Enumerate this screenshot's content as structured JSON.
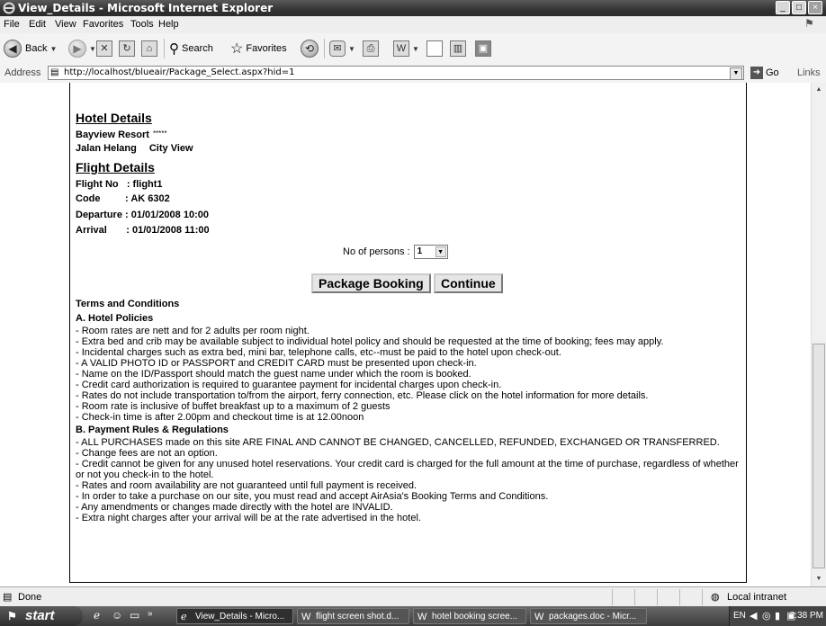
{
  "window": {
    "title": "View_Details - Microsoft Internet Explorer",
    "buttons": {
      "minimize": "_",
      "maximize": "□",
      "close": "×"
    }
  },
  "menu": [
    "File",
    "Edit",
    "View",
    "Favorites",
    "Tools",
    "Help"
  ],
  "toolbar": {
    "back_label": "Back",
    "search_label": "Search",
    "favorites_label": "Favorites"
  },
  "address": {
    "label": "Address",
    "url": "http://localhost/blueair/Package_Select.aspx?hid=1",
    "go_label": "Go",
    "links_label": "Links"
  },
  "page": {
    "hotel_heading": "Hotel Details",
    "hotel_name": "Bayview Resort",
    "hotel_stars": "*****",
    "hotel_location": "Jalan Helang",
    "hotel_view": "City View",
    "flight_heading": "Flight Details",
    "flight_no": "Flight No   : flight1",
    "flight_code": "Code         : AK 6302",
    "flight_departure": "Departure : 01/01/2008 10:00",
    "flight_arrival": "Arrival       : 01/01/2008 11:00",
    "persons_label": "No of persons :",
    "persons_value": "1",
    "package_booking_label": "Package Booking",
    "continue_label": "Continue",
    "terms_title": "Terms and Conditions",
    "hotel_policies_title": "A. Hotel Policies",
    "hotel_policies": [
      "- Room rates are nett and for 2 adults per room night.",
      "- Extra bed and crib may be available subject to individual hotel policy and should be requested at the time of booking; fees may apply.",
      "- Incidental charges such as extra bed, mini bar, telephone calls, etc--must be paid to the hotel upon check-out.",
      "- A VALID PHOTO ID or PASSPORT and CREDIT CARD must be presented upon check-in.",
      "- Name on the ID/Passport should match the guest name under which the room is booked.",
      "- Credit card authorization is required to guarantee payment for incidental charges upon check-in.",
      "- Rates do not include transportation to/from the airport, ferry connection, etc. Please click on the hotel information for more details.",
      "- Room rate is inclusive of buffet breakfast up to a maximum of 2 guests",
      "- Check-in time is after 2.00pm and checkout time is at 12.00noon"
    ],
    "payment_title": "B. Payment Rules & Regulations",
    "payment_rules": [
      "- ALL PURCHASES made on this site ARE FINAL AND CANNOT BE CHANGED, CANCELLED, REFUNDED, EXCHANGED OR TRANSFERRED.",
      "- Change fees are not an option.",
      "- Credit cannot be given for any unused hotel reservations. Your credit card is charged for the full amount at the time of purchase, regardless of whether or not you check-in to the hotel.",
      "- Rates and room availability are not guaranteed until full payment is received.",
      "- In order to take a purchase on our site, you must read and accept AirAsia's Booking Terms and Conditions.",
      "- Any amendments or changes made directly with the hotel are INVALID.",
      "- Extra night charges after your arrival will be at the rate advertised in the hotel."
    ]
  },
  "status": {
    "text": "Done",
    "zone": "Local intranet"
  },
  "taskbar": {
    "start": "start",
    "tasks": [
      "View_Details - Micro...",
      "flight screen shot.d...",
      "hotel booking scree...",
      "packages.doc - Micr..."
    ],
    "lang": "EN",
    "clock": "2:38 PM"
  }
}
